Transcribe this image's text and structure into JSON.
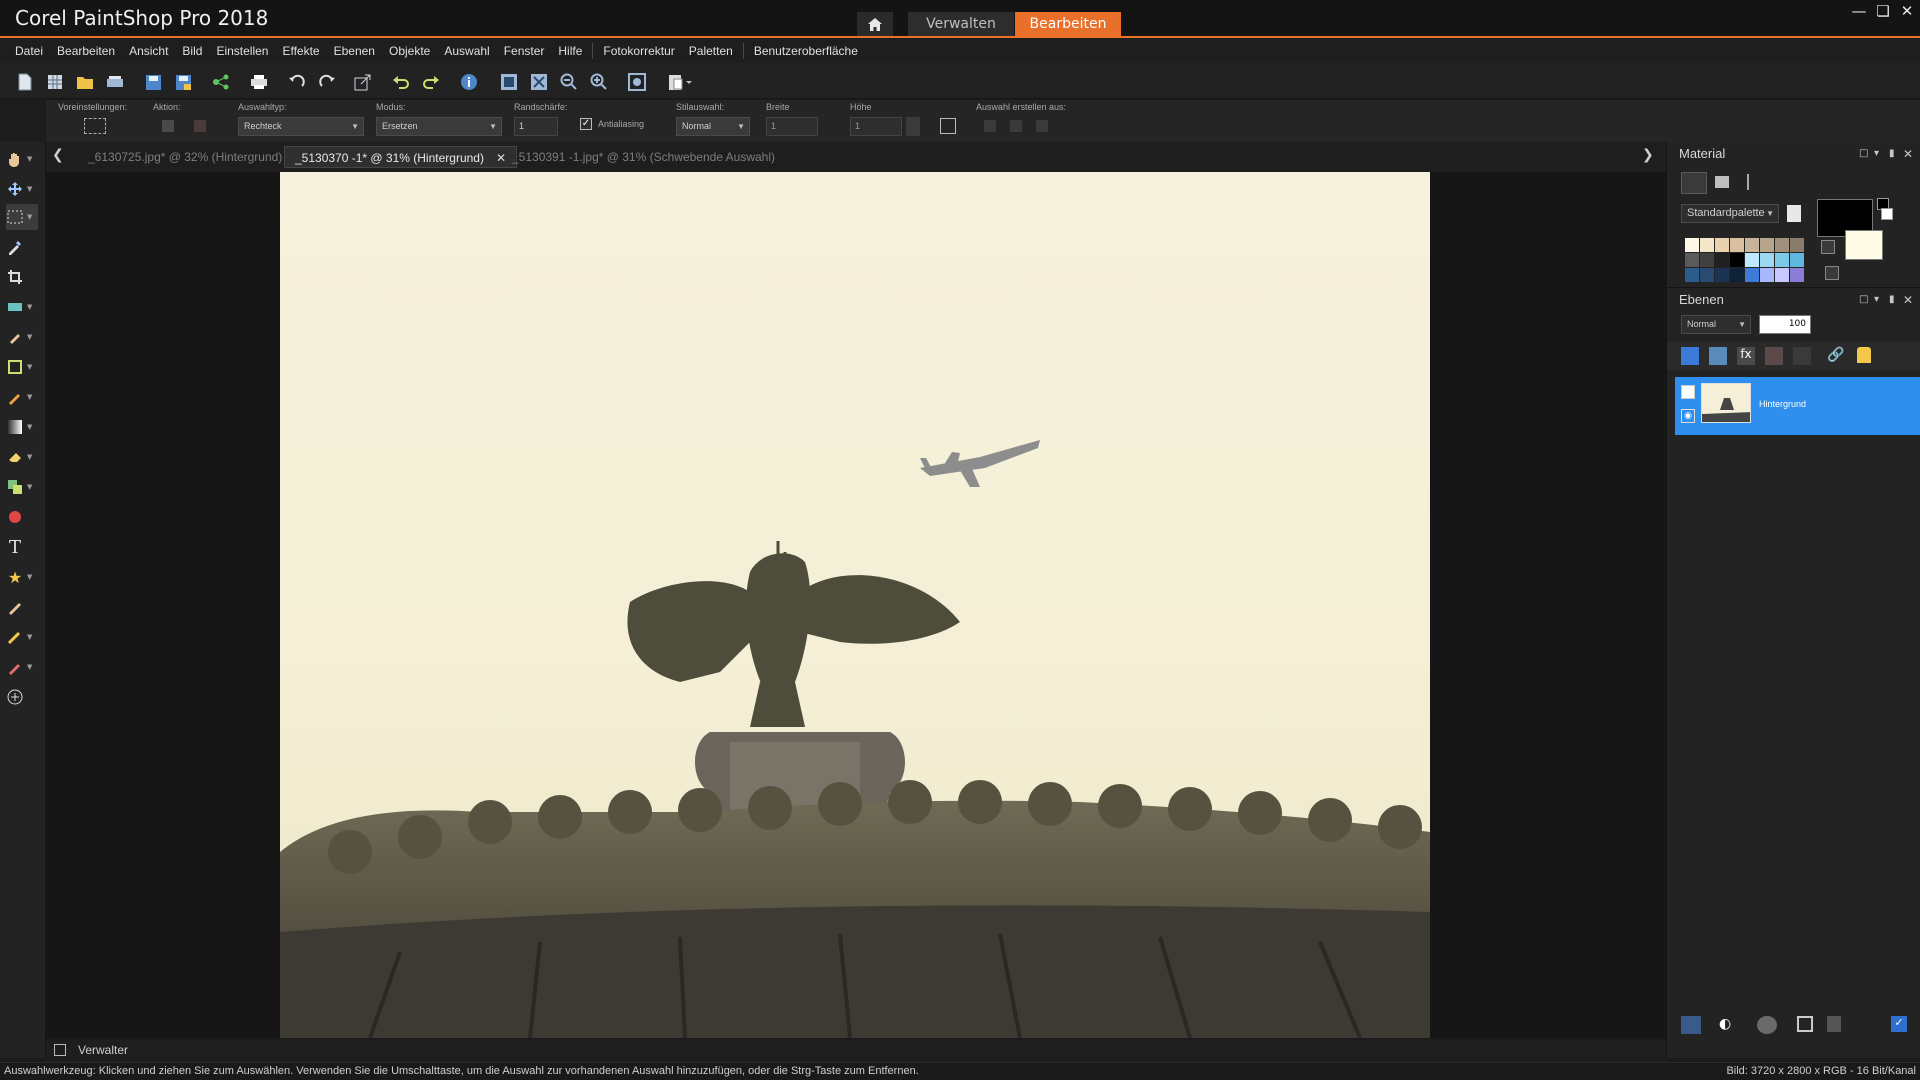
{
  "app": {
    "title": "Corel PaintShop Pro 2018",
    "workspace_tabs": [
      {
        "label": "Verwalten",
        "active": false
      },
      {
        "label": "Bearbeiten",
        "active": true
      }
    ],
    "accent_color": "#e8702a"
  },
  "menu": [
    "Datei",
    "Bearbeiten",
    "Ansicht",
    "Bild",
    "Einstellen",
    "Effekte",
    "Ebenen",
    "Objekte",
    "Auswahl",
    "Fenster",
    "Hilfe",
    "Fotokorrektur",
    "Paletten",
    "Benutzeroberfläche"
  ],
  "options": {
    "presets_label": "Voreinstellungen:",
    "action_label": "Aktion:",
    "selection_type_label": "Auswahltyp:",
    "selection_type_value": "Rechteck",
    "mode_label": "Modus:",
    "mode_value": "Ersetzen",
    "feather_label": "Randschärfe:",
    "feather_value": "1",
    "antialias_label": "Antialiasing",
    "antialias_checked": true,
    "style_label": "Stilauswahl:",
    "style_value": "Normal",
    "width_label": "Breite",
    "width_value": "1",
    "height_label": "Höhe",
    "height_value": "1",
    "create_from_label": "Auswahl erstellen aus:"
  },
  "doc_tabs": [
    {
      "label": "_6130725.jpg* @  32% (Hintergrund)",
      "active": false
    },
    {
      "label": "_5130370 -1* @  31% (Hintergrund)",
      "active": true
    },
    {
      "label": "_5130391 -1.jpg* @  31% (Schwebende Auswahl)",
      "active": false
    }
  ],
  "materials": {
    "title": "Material",
    "palette_name": "Standardpalette"
  },
  "layers": {
    "title": "Ebenen",
    "blend_mode": "Normal",
    "opacity": "100",
    "items": [
      {
        "name": "Hintergrund",
        "selected": true
      }
    ]
  },
  "bottom_tab": {
    "label": "Verwalter"
  },
  "status": {
    "message": "Auswahlwerkzeug: Klicken und ziehen Sie zum Auswählen. Verwenden Sie die Umschalttaste, um die Auswahl zur vorhandenen Auswahl hinzuzufügen, oder die Strg-Taste zum Entfernen.",
    "image_info": "Bild:  3720 x 2800 x RGB - 16 Bit/Kanal"
  },
  "icons": {
    "home": "home-icon"
  }
}
